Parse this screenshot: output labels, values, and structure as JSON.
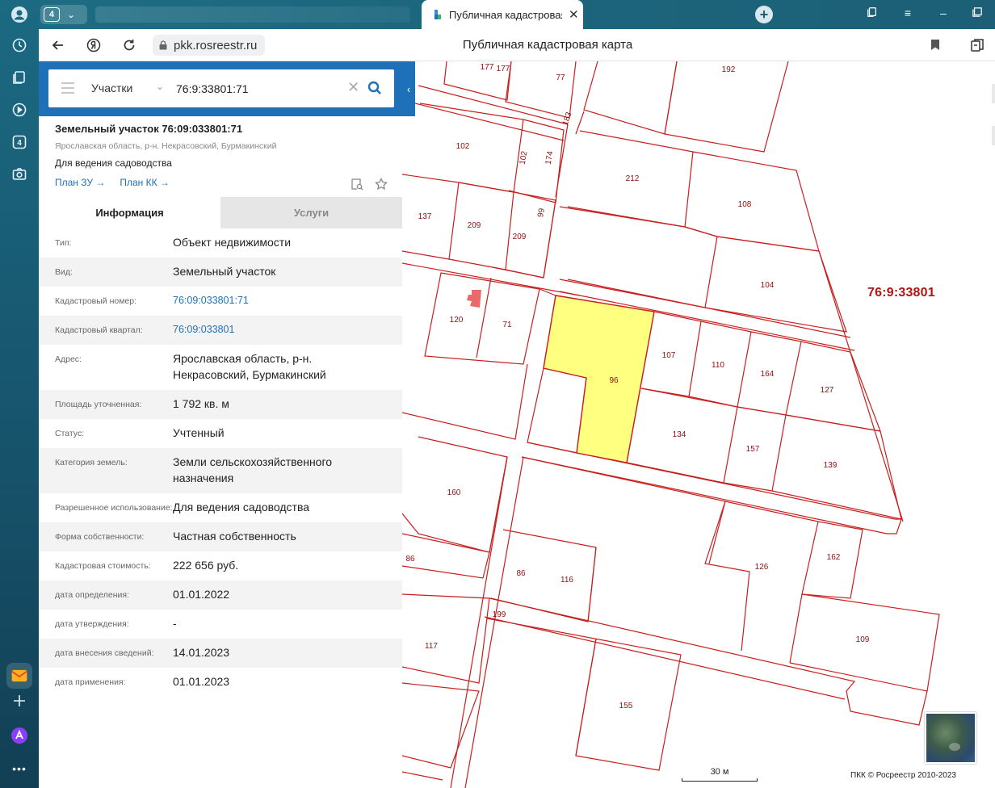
{
  "tabs_counter": "4",
  "active_tab": {
    "title": "Публичная кадастровая"
  },
  "address": {
    "url": "pkk.rosreestr.ru",
    "page_title": "Публичная кадастровая карта"
  },
  "rail": {
    "badge": "4"
  },
  "search": {
    "type": "Участки",
    "value": "76:9:33801:71"
  },
  "object": {
    "title": "Земельный участок 76:09:033801:71",
    "address": "Ярославская область, р-н. Некрасовский, Бурмакинский",
    "use": "Для ведения садоводства",
    "link_plan_zu": "План ЗУ",
    "link_plan_kk": "План КК"
  },
  "info_tabs": {
    "info": "Информация",
    "services": "Услуги"
  },
  "properties": [
    {
      "key": "Тип:",
      "value": "Объект недвижимости"
    },
    {
      "key": "Вид:",
      "value": "Земельный участок"
    },
    {
      "key": "Кадастровый номер:",
      "value": "76:09:033801:71"
    },
    {
      "key": "Кадастровый квартал:",
      "value": "76:09:033801"
    },
    {
      "key": "Адрес:",
      "value": "Ярославская область, р-н. Некрасовский, Бурмакинский"
    },
    {
      "key": "Площадь уточненная:",
      "value": "1 792 кв. м"
    },
    {
      "key": "Статус:",
      "value": "Учтенный"
    },
    {
      "key": "Категория земель:",
      "value": "Земли сельскохозяйственного назначения"
    },
    {
      "key": "Разрешенное использование:",
      "value": "Для ведения садоводства"
    },
    {
      "key": "Форма собственности:",
      "value": "Частная собственность"
    },
    {
      "key": "Кадастровая стоимость:",
      "value": "222 656 руб."
    },
    {
      "key": "дата определения:",
      "value": "01.01.2022"
    },
    {
      "key": "дата утверждения:",
      "value": "-"
    },
    {
      "key": "дата внесения сведений:",
      "value": "14.01.2023"
    },
    {
      "key": "дата применения:",
      "value": "01.01.2023"
    }
  ],
  "map": {
    "quarter": "76:9:33801",
    "scale": "30 м",
    "copyright": "ПКК © Росреестр 2010-2023",
    "parcels": [
      "177",
      "177",
      "77",
      "192",
      "183",
      "102",
      "102",
      "174",
      "212",
      "108",
      "137",
      "209",
      "209",
      "99",
      "104",
      "120",
      "71",
      "96",
      "107",
      "110",
      "164",
      "127",
      "134",
      "157",
      "139",
      "160",
      "86",
      "86",
      "116",
      "126",
      "162",
      "199",
      "117",
      "109",
      "155"
    ],
    "highlight_color": "#ffff80",
    "border_color": "#c81e1e"
  }
}
